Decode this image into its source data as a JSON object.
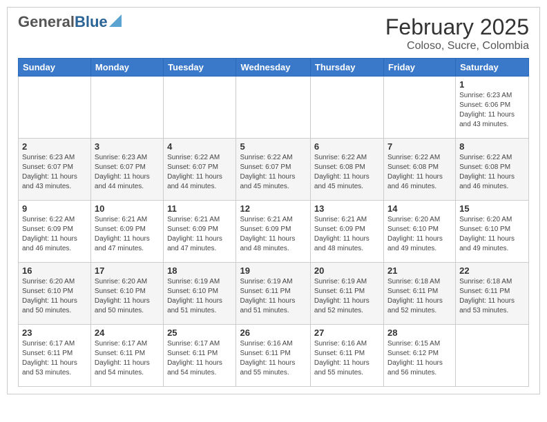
{
  "header": {
    "logo_general": "General",
    "logo_blue": "Blue",
    "month_title": "February 2025",
    "location": "Coloso, Sucre, Colombia"
  },
  "weekdays": [
    "Sunday",
    "Monday",
    "Tuesday",
    "Wednesday",
    "Thursday",
    "Friday",
    "Saturday"
  ],
  "weeks": [
    [
      {
        "day": "",
        "info": ""
      },
      {
        "day": "",
        "info": ""
      },
      {
        "day": "",
        "info": ""
      },
      {
        "day": "",
        "info": ""
      },
      {
        "day": "",
        "info": ""
      },
      {
        "day": "",
        "info": ""
      },
      {
        "day": "1",
        "info": "Sunrise: 6:23 AM\nSunset: 6:06 PM\nDaylight: 11 hours\nand 43 minutes."
      }
    ],
    [
      {
        "day": "2",
        "info": "Sunrise: 6:23 AM\nSunset: 6:07 PM\nDaylight: 11 hours\nand 43 minutes."
      },
      {
        "day": "3",
        "info": "Sunrise: 6:23 AM\nSunset: 6:07 PM\nDaylight: 11 hours\nand 44 minutes."
      },
      {
        "day": "4",
        "info": "Sunrise: 6:22 AM\nSunset: 6:07 PM\nDaylight: 11 hours\nand 44 minutes."
      },
      {
        "day": "5",
        "info": "Sunrise: 6:22 AM\nSunset: 6:07 PM\nDaylight: 11 hours\nand 45 minutes."
      },
      {
        "day": "6",
        "info": "Sunrise: 6:22 AM\nSunset: 6:08 PM\nDaylight: 11 hours\nand 45 minutes."
      },
      {
        "day": "7",
        "info": "Sunrise: 6:22 AM\nSunset: 6:08 PM\nDaylight: 11 hours\nand 46 minutes."
      },
      {
        "day": "8",
        "info": "Sunrise: 6:22 AM\nSunset: 6:08 PM\nDaylight: 11 hours\nand 46 minutes."
      }
    ],
    [
      {
        "day": "9",
        "info": "Sunrise: 6:22 AM\nSunset: 6:09 PM\nDaylight: 11 hours\nand 46 minutes."
      },
      {
        "day": "10",
        "info": "Sunrise: 6:21 AM\nSunset: 6:09 PM\nDaylight: 11 hours\nand 47 minutes."
      },
      {
        "day": "11",
        "info": "Sunrise: 6:21 AM\nSunset: 6:09 PM\nDaylight: 11 hours\nand 47 minutes."
      },
      {
        "day": "12",
        "info": "Sunrise: 6:21 AM\nSunset: 6:09 PM\nDaylight: 11 hours\nand 48 minutes."
      },
      {
        "day": "13",
        "info": "Sunrise: 6:21 AM\nSunset: 6:09 PM\nDaylight: 11 hours\nand 48 minutes."
      },
      {
        "day": "14",
        "info": "Sunrise: 6:20 AM\nSunset: 6:10 PM\nDaylight: 11 hours\nand 49 minutes."
      },
      {
        "day": "15",
        "info": "Sunrise: 6:20 AM\nSunset: 6:10 PM\nDaylight: 11 hours\nand 49 minutes."
      }
    ],
    [
      {
        "day": "16",
        "info": "Sunrise: 6:20 AM\nSunset: 6:10 PM\nDaylight: 11 hours\nand 50 minutes."
      },
      {
        "day": "17",
        "info": "Sunrise: 6:20 AM\nSunset: 6:10 PM\nDaylight: 11 hours\nand 50 minutes."
      },
      {
        "day": "18",
        "info": "Sunrise: 6:19 AM\nSunset: 6:10 PM\nDaylight: 11 hours\nand 51 minutes."
      },
      {
        "day": "19",
        "info": "Sunrise: 6:19 AM\nSunset: 6:11 PM\nDaylight: 11 hours\nand 51 minutes."
      },
      {
        "day": "20",
        "info": "Sunrise: 6:19 AM\nSunset: 6:11 PM\nDaylight: 11 hours\nand 52 minutes."
      },
      {
        "day": "21",
        "info": "Sunrise: 6:18 AM\nSunset: 6:11 PM\nDaylight: 11 hours\nand 52 minutes."
      },
      {
        "day": "22",
        "info": "Sunrise: 6:18 AM\nSunset: 6:11 PM\nDaylight: 11 hours\nand 53 minutes."
      }
    ],
    [
      {
        "day": "23",
        "info": "Sunrise: 6:17 AM\nSunset: 6:11 PM\nDaylight: 11 hours\nand 53 minutes."
      },
      {
        "day": "24",
        "info": "Sunrise: 6:17 AM\nSunset: 6:11 PM\nDaylight: 11 hours\nand 54 minutes."
      },
      {
        "day": "25",
        "info": "Sunrise: 6:17 AM\nSunset: 6:11 PM\nDaylight: 11 hours\nand 54 minutes."
      },
      {
        "day": "26",
        "info": "Sunrise: 6:16 AM\nSunset: 6:11 PM\nDaylight: 11 hours\nand 55 minutes."
      },
      {
        "day": "27",
        "info": "Sunrise: 6:16 AM\nSunset: 6:11 PM\nDaylight: 11 hours\nand 55 minutes."
      },
      {
        "day": "28",
        "info": "Sunrise: 6:15 AM\nSunset: 6:12 PM\nDaylight: 11 hours\nand 56 minutes."
      },
      {
        "day": "",
        "info": ""
      }
    ]
  ]
}
